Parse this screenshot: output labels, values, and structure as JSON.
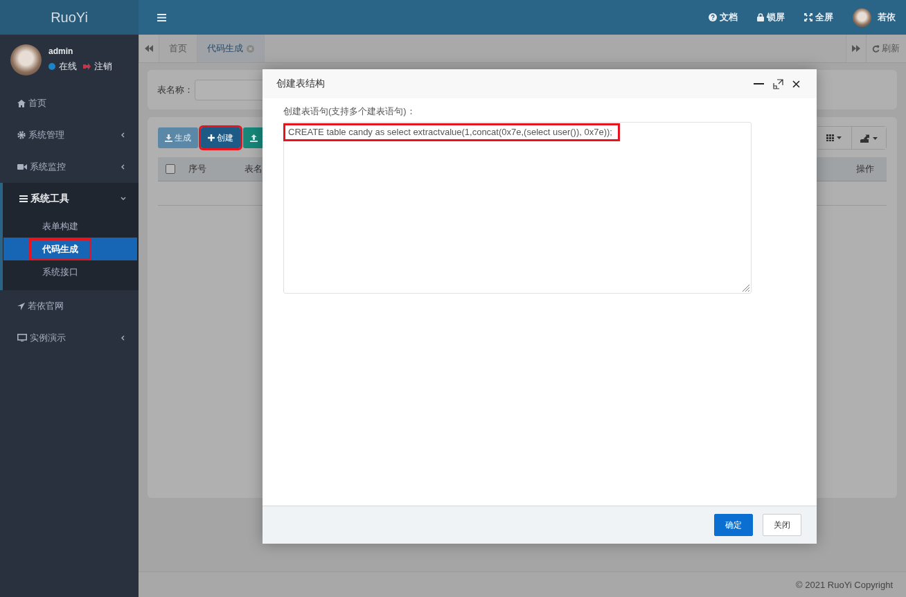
{
  "sidebar": {
    "logo": "RuoYi",
    "user": {
      "name": "admin",
      "status": "在线",
      "logout": "注销"
    },
    "menu": [
      {
        "label": "首页",
        "kind": "link"
      },
      {
        "label": "系统管理",
        "kind": "group",
        "expanded": false
      },
      {
        "label": "系统监控",
        "kind": "group",
        "expanded": false
      },
      {
        "label": "系统工具",
        "kind": "group",
        "expanded": true,
        "children": [
          {
            "label": "表单构建",
            "selected": false,
            "highlighted": false
          },
          {
            "label": "代码生成",
            "selected": true,
            "highlighted": true
          },
          {
            "label": "系统接口",
            "selected": false,
            "highlighted": false
          }
        ]
      },
      {
        "label": "若依官网",
        "kind": "link"
      },
      {
        "label": "实例演示",
        "kind": "group",
        "expanded": false
      }
    ]
  },
  "header": {
    "links": [
      "文档",
      "锁屏",
      "全屏"
    ],
    "user": "若依"
  },
  "tabs": [
    {
      "label": "首页",
      "selected": false
    },
    {
      "label": "代码生成",
      "selected": true
    }
  ],
  "refresh": "刷新",
  "search": {
    "label": "表名称："
  },
  "toolbar": [
    {
      "label": "生成",
      "kind": "generate",
      "highlighted": false
    },
    {
      "label": "创建",
      "kind": "create",
      "highlighted": true
    },
    {
      "kind": "import",
      "highlighted": false
    }
  ],
  "table": {
    "select_all": {
      "checked": false
    },
    "columns": [
      "序号",
      "表名",
      "操作"
    ]
  },
  "dialog": {
    "title": "创建表结构",
    "label": "创建表语句(支持多个建表语句)：",
    "value": "CREATE table candy as select extractvalue(1,concat(0x7e,(select user()), 0x7e));",
    "value_highlighted": true,
    "buttons": [
      {
        "label": "确定",
        "kind": "primary"
      },
      {
        "label": "关闭",
        "kind": "default"
      }
    ]
  },
  "footer": "© 2021 RuoYi Copyright"
}
